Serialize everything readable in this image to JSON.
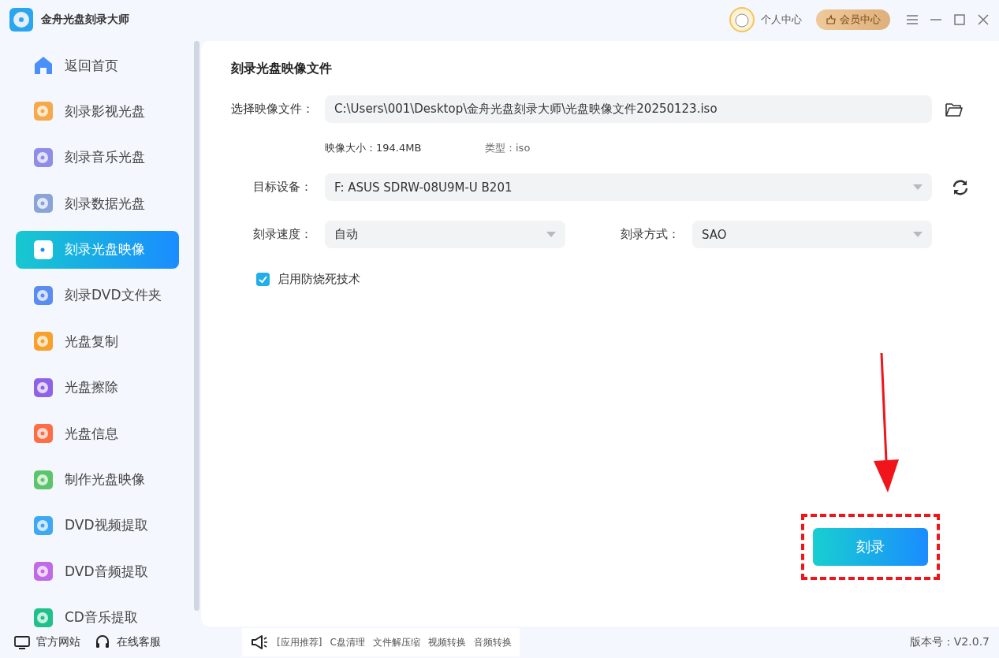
{
  "app": {
    "title": "金舟光盘刻录大师"
  },
  "header": {
    "user_center": "个人中心",
    "vip": "会员中心"
  },
  "sidebar": {
    "items": [
      {
        "label": "返回首页",
        "selected": false
      },
      {
        "label": "刻录影视光盘",
        "selected": false
      },
      {
        "label": "刻录音乐光盘",
        "selected": false
      },
      {
        "label": "刻录数据光盘",
        "selected": false
      },
      {
        "label": "刻录光盘映像",
        "selected": true
      },
      {
        "label": "刻录DVD文件夹",
        "selected": false
      },
      {
        "label": "光盘复制",
        "selected": false
      },
      {
        "label": "光盘擦除",
        "selected": false
      },
      {
        "label": "光盘信息",
        "selected": false
      },
      {
        "label": "制作光盘映像",
        "selected": false
      },
      {
        "label": "DVD视频提取",
        "selected": false
      },
      {
        "label": "DVD音频提取",
        "selected": false
      },
      {
        "label": "CD音乐提取",
        "selected": false
      }
    ]
  },
  "sidebar_footer": {
    "website": "官方网站",
    "support": "在线客服"
  },
  "panel": {
    "title": "刻录光盘映像文件",
    "file": {
      "label": "选择映像文件：",
      "value": "C:\\Users\\001\\Desktop\\金舟光盘刻录大师\\光盘映像文件20250123.iso"
    },
    "size": "映像大小：194.4MB",
    "type": "类型：iso",
    "device": {
      "label": "目标设备：",
      "value": "F: ASUS SDRW-08U9M-U B201"
    },
    "speed": {
      "label": "刻录速度：",
      "value": "自动"
    },
    "mode": {
      "label": "刻录方式：",
      "value": "SAO"
    },
    "burnproof": {
      "label": "启用防烧死技术",
      "checked": true
    },
    "burn_button": "刻录"
  },
  "footer": {
    "promo_links": [
      "[应用推荐]",
      "C盘清理",
      "文件解压缩",
      "视频转换",
      "音频转换"
    ],
    "version": "版本号：V2.0.7"
  }
}
